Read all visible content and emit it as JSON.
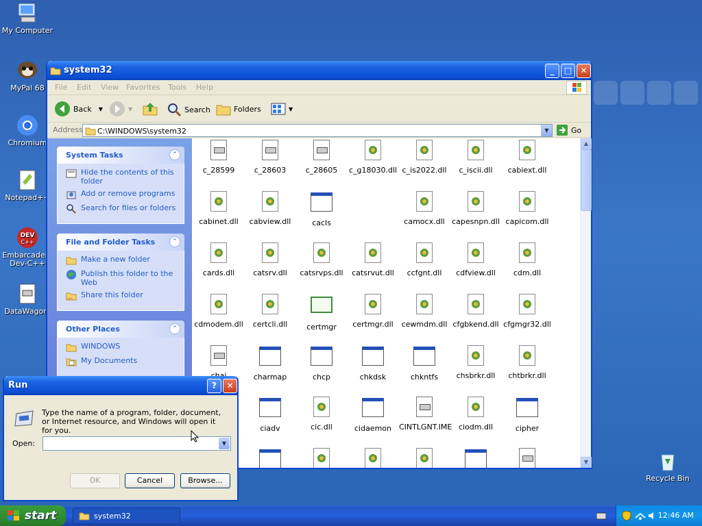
{
  "desktop": {
    "icons": [
      {
        "label": "My Computer",
        "icon": "my-computer-icon"
      },
      {
        "label": "MyPal 68",
        "icon": "mypal-icon"
      },
      {
        "label": "Chromium",
        "icon": "chromium-icon"
      },
      {
        "label": "Notepad++",
        "icon": "notepadpp-icon"
      },
      {
        "label": "Embarcadero Dev-C++",
        "icon": "devcpp-icon",
        "line1": "Embarcadero",
        "line2": "Dev-C++"
      },
      {
        "label": "DataWagon.",
        "icon": "datawagon-icon"
      },
      {
        "label": "Recycle Bin",
        "icon": "recycle-bin-icon"
      }
    ]
  },
  "explorer": {
    "title": "system32",
    "menu": [
      "File",
      "Edit",
      "View",
      "Favorites",
      "Tools",
      "Help"
    ],
    "toolbar": {
      "back": "Back",
      "search": "Search",
      "folders": "Folders"
    },
    "address": {
      "label": "Address",
      "value": "C:\\WINDOWS\\system32",
      "go": "Go"
    },
    "system_tasks": {
      "title": "System Tasks",
      "items": [
        "Hide the contents of this folder",
        "Add or remove programs",
        "Search for files or folders"
      ]
    },
    "file_folder_tasks": {
      "title": "File and Folder Tasks",
      "items": [
        "Make a new folder",
        "Publish this folder to the Web",
        "Share this folder"
      ]
    },
    "other_places": {
      "title": "Other Places",
      "items": [
        "WINDOWS",
        "My Documents"
      ]
    },
    "files": [
      {
        "name": "c_28599",
        "type": "nls"
      },
      {
        "name": "c_28603",
        "type": "nls"
      },
      {
        "name": "c_28605",
        "type": "nls"
      },
      {
        "name": "c_g18030.dll",
        "type": "dll"
      },
      {
        "name": "c_is2022.dll",
        "type": "dll"
      },
      {
        "name": "c_iscii.dll",
        "type": "dll"
      },
      {
        "name": "cabiext.dll",
        "type": "dll"
      },
      {
        "name": "cabinet.dll",
        "type": "dll"
      },
      {
        "name": "cabview.dll",
        "type": "dll"
      },
      {
        "name": "cacls",
        "type": "exe"
      },
      {
        "name": "",
        "type": "none"
      },
      {
        "name": "camocx.dll",
        "type": "dll"
      },
      {
        "name": "capesnpn.dll",
        "type": "dll"
      },
      {
        "name": "capicom.dll",
        "type": "dll"
      },
      {
        "name": "cards.dll",
        "type": "dll"
      },
      {
        "name": "catsrv.dll",
        "type": "dll"
      },
      {
        "name": "catsrvps.dll",
        "type": "dll"
      },
      {
        "name": "catsrvut.dll",
        "type": "dll"
      },
      {
        "name": "ccfgnt.dll",
        "type": "dll"
      },
      {
        "name": "cdfview.dll",
        "type": "dll"
      },
      {
        "name": "cdm.dll",
        "type": "dll"
      },
      {
        "name": "cdmodem.dll",
        "type": "dll"
      },
      {
        "name": "certcli.dll",
        "type": "dll"
      },
      {
        "name": "certmgr",
        "type": "cert"
      },
      {
        "name": "certmgr.dll",
        "type": "dll"
      },
      {
        "name": "cewmdm.dll",
        "type": "dll"
      },
      {
        "name": "cfgbkend.dll",
        "type": "dll"
      },
      {
        "name": "cfgmgr32.dll",
        "type": "dll"
      },
      {
        "name": "chaj",
        "type": "nls"
      },
      {
        "name": "charmap",
        "type": "exe"
      },
      {
        "name": "chcp",
        "type": "exe"
      },
      {
        "name": "chkdsk",
        "type": "exe"
      },
      {
        "name": "chkntfs",
        "type": "exe"
      },
      {
        "name": "chsbrkr.dll",
        "type": "dll"
      },
      {
        "name": "chtbrkr.dll",
        "type": "dll"
      },
      {
        "name": "",
        "type": "none"
      },
      {
        "name": "ciadv",
        "type": "exe"
      },
      {
        "name": "cic.dll",
        "type": "dll"
      },
      {
        "name": "cidaemon",
        "type": "exe"
      },
      {
        "name": "CINTLGNT.IME",
        "type": "nls"
      },
      {
        "name": "ciodm.dll",
        "type": "dll"
      },
      {
        "name": "cipher",
        "type": "exe"
      },
      {
        "name": "",
        "type": "none"
      },
      {
        "name": "",
        "type": "exe"
      },
      {
        "name": "",
        "type": "dll"
      },
      {
        "name": "",
        "type": "dll"
      },
      {
        "name": "",
        "type": "dll"
      },
      {
        "name": "",
        "type": "exe"
      },
      {
        "name": "",
        "type": "nls"
      }
    ]
  },
  "run_dialog": {
    "title": "Run",
    "description": "Type the name of a program, folder, document, or Internet resource, and Windows will open it for you.",
    "open_label": "Open:",
    "open_value": "",
    "ok": "OK",
    "cancel": "Cancel",
    "browse": "Browse..."
  },
  "taskbar": {
    "start": "start",
    "tasks": [
      {
        "label": "system32"
      }
    ],
    "clock": "12:46 AM"
  }
}
